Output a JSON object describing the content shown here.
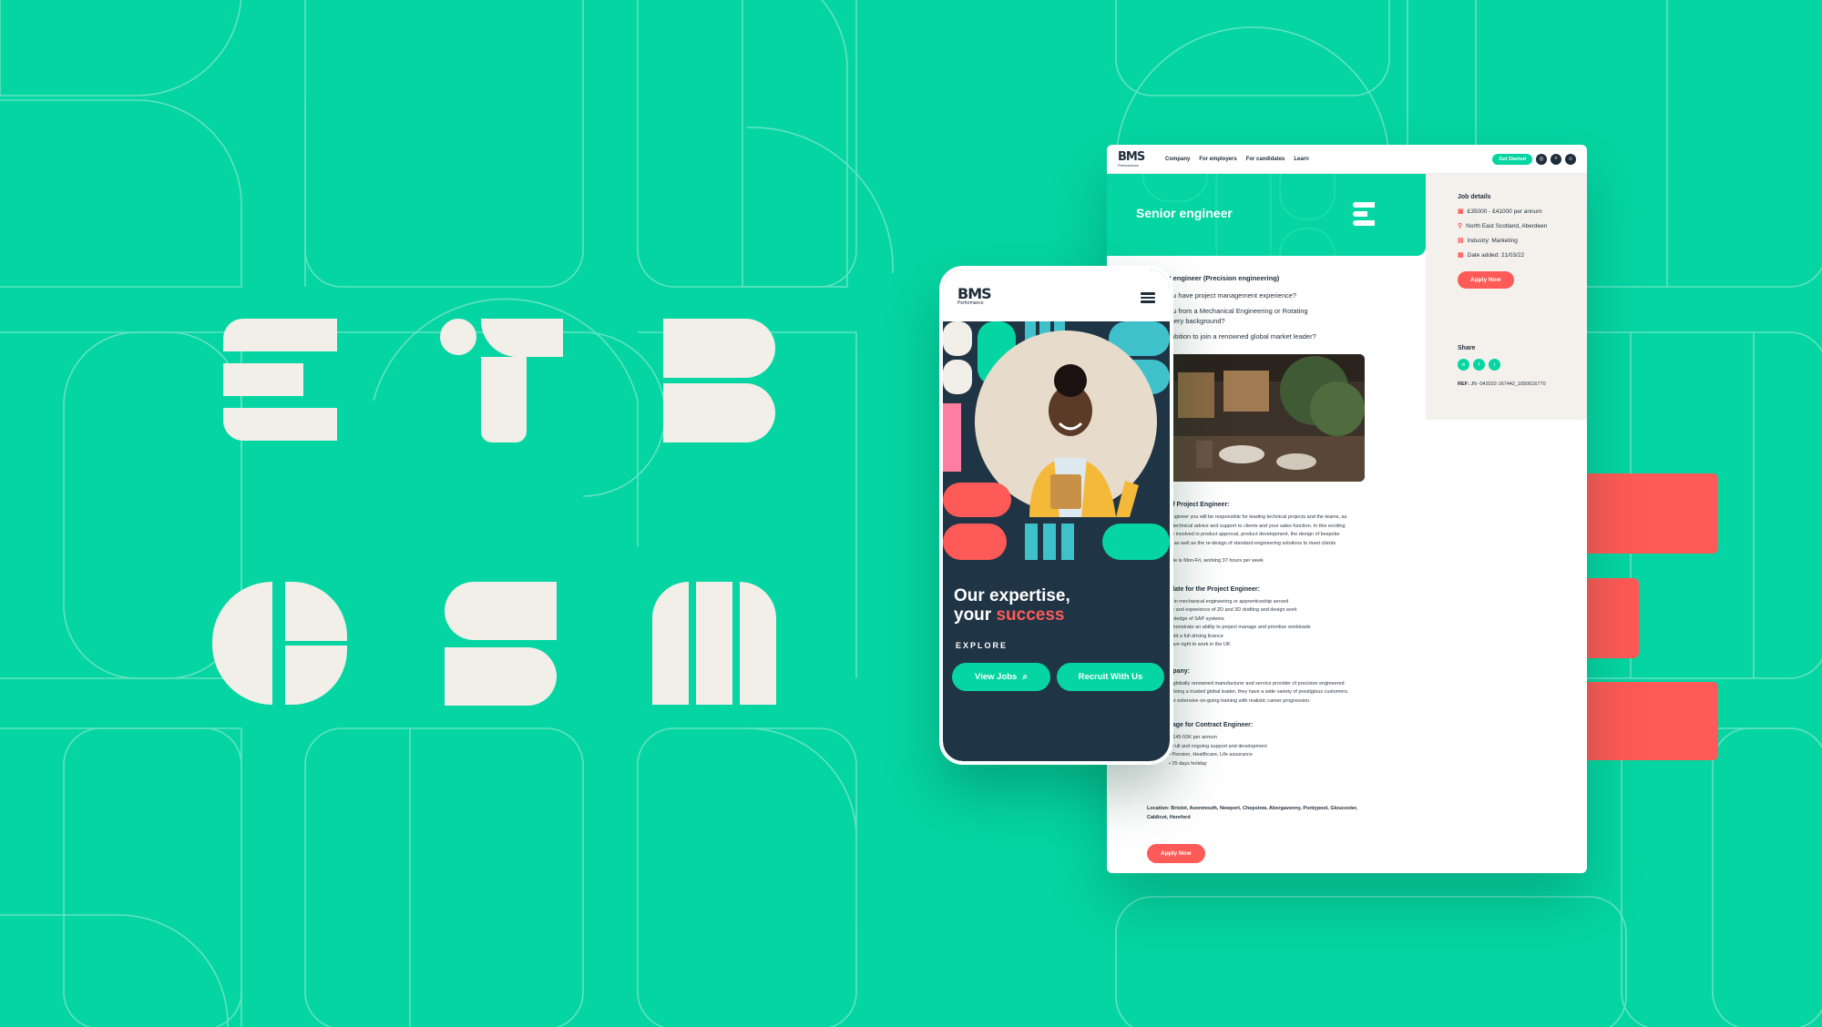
{
  "colors": {
    "background": "#05d5a2",
    "navy": "#1e2d3b",
    "coral": "#fe5a57",
    "cream": "#f2eee8",
    "teal": "#3fc1cb"
  },
  "desktop": {
    "logo": {
      "mark": "BMS",
      "sub": "Performance"
    },
    "nav": [
      "Company",
      "For employers",
      "For candidates",
      "Learn"
    ],
    "cta": "Get Started",
    "header_icons": [
      "globe-icon",
      "search-icon",
      "user-icon"
    ],
    "hero_title": "Senior engineer",
    "job_details": {
      "heading": "Job details",
      "salary": "£35000 - £41000 per annum",
      "location": "North East Scotland, Aberdeen",
      "industry": "Industry: Marketing",
      "date": "Date added: 21/03/22"
    },
    "apply_label": "Apply Now",
    "share": {
      "heading": "Share",
      "icons": [
        "in",
        "f",
        "t"
      ],
      "ref_label": "REF:",
      "ref_value": "JN -042022-167442_1650616770"
    },
    "body": {
      "h1": "t engineer (Precision engineering)",
      "questions": [
        "ou have project management experience?",
        "ou from a Mechanical Engineering or Rotating\ninery background?",
        "mbition to join a renowned global market leader?"
      ],
      "sections": [
        {
          "title": "of Project Engineer:",
          "text": "Engineer you will be responsible for leading technical projects and the teams, as\ng technical advice and support to clients and your sales function. In this exciting\nbe involved in product approval, product development, the design of bespoke\ns, as well as the re-design of standard engineering solutions to meet clients",
          "extra": "role is Mon-Fri, working 37 hours per week"
        },
        {
          "title": "idate for the Project Engineer:",
          "text": "D in mechanical engineering or apprenticeship served\nge and experience of 2D and 3D drafting and design work\nowledge of SAP systems\nemonstrate an ability to project manage and prioritise workloads\nhold a full driving licence\nhave right to work in the UK"
        },
        {
          "title": "npany:",
          "text": "a globally renowned manufacturer and service provider of precision engineered\n. Being a trusted global leader, they have a wide variety of prestigious customers.\nffer extensive on-going training with realistic career progression."
        },
        {
          "title": "kage for Contract Engineer:",
          "text": "y £45-50K per annum\n•  Full and ongoing support and development\n•  Pension, Healthcare, Life assurance\n•  25 days holiday"
        }
      ],
      "location_line": "Location: Bristol, Avonmouth, Newport, Chepstow, Abergavenny, Pontypool, Gloucester,\nCaldicot, Hereford"
    }
  },
  "mobile": {
    "logo": {
      "mark": "BMS",
      "sub": "Performance"
    },
    "title_line1": "Our expertise,",
    "title_line2_prefix": "your ",
    "title_line2_accent": "success",
    "explore": "EXPLORE",
    "view_jobs": "View Jobs",
    "recruit": "Recruit With Us"
  }
}
